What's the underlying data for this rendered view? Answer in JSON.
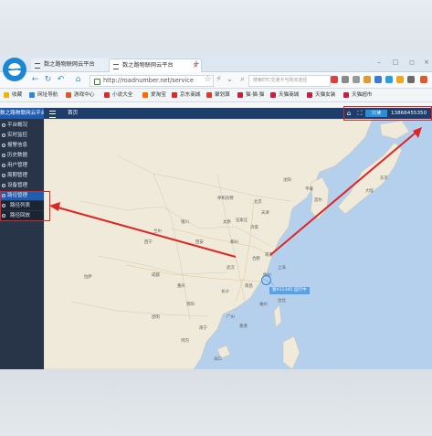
{
  "browser": {
    "tabs": [
      {
        "label": "数之路物联网云平台"
      },
      {
        "label": "数之路物联网云平台"
      }
    ],
    "new_tab": "+",
    "url": "http://roadnumber.net/service",
    "search_placeholder": "搜索ETC交通卡与购买途径"
  },
  "bookmarks": [
    {
      "label": "收藏",
      "color": "#f0b400"
    },
    {
      "label": "网址导航",
      "color": "#2e86d8"
    },
    {
      "label": "游戏中心",
      "color": "#e0562b"
    },
    {
      "label": "小说大全",
      "color": "#d92b2b"
    },
    {
      "label": "爱淘宝",
      "color": "#ff6a00"
    },
    {
      "label": "京东商城",
      "color": "#d92b2b"
    },
    {
      "label": "聚划算",
      "color": "#e0362b"
    },
    {
      "label": "猫·猫·猫",
      "color": "#c51f3d"
    },
    {
      "label": "天猫商城",
      "color": "#c51f3d"
    },
    {
      "label": "天猫女装",
      "color": "#c51f3d"
    },
    {
      "label": "天猫超市",
      "color": "#c51f3d"
    }
  ],
  "app": {
    "name": "数之路物联网云平台",
    "home": "首页",
    "read_only": "只读",
    "phone": "13866455350",
    "sidebar": [
      {
        "label": "平台概况"
      },
      {
        "label": "实时监控"
      },
      {
        "label": "报警信息"
      },
      {
        "label": "历史数据"
      },
      {
        "label": "用户管理"
      },
      {
        "label": "周期管理"
      },
      {
        "label": "设备管理"
      },
      {
        "label": "路径管理"
      },
      {
        "label": "路径列表"
      },
      {
        "label": "路径回放"
      }
    ],
    "selected": 7
  },
  "map": {
    "labels": [
      "北京",
      "天津",
      "沈阳",
      "首尔",
      "东京",
      "上海",
      "杭州",
      "武汉",
      "成都",
      "重庆",
      "西安",
      "兰州",
      "郑州",
      "长沙",
      "福州",
      "台北",
      "广州",
      "香港",
      "南宁",
      "昆明",
      "贵阳",
      "南昌",
      "合肥",
      "南京",
      "济南",
      "石家庄",
      "太原",
      "呼和浩特",
      "银川",
      "西宁",
      "拉萨",
      "河内",
      "大阪",
      "平壤",
      "海口"
    ],
    "vehicle_label": "浙A12345 运行中"
  },
  "colors": {
    "accent": "#1e5bb0",
    "annotation": "#e02323",
    "sidebar": "#283448"
  }
}
